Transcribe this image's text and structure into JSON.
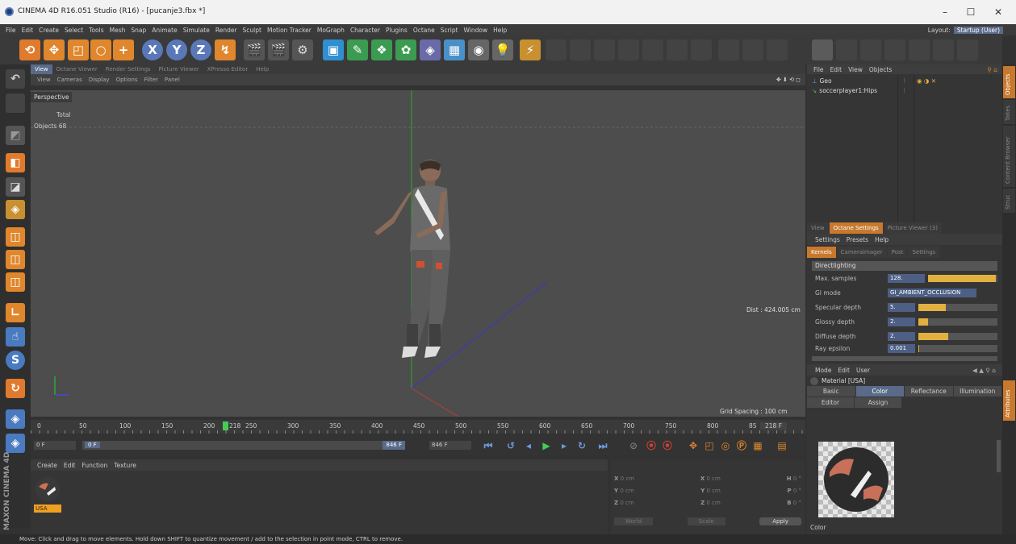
{
  "window": {
    "title": "CINEMA 4D R16.051 Studio (R16) - [pucanje3.fbx *]",
    "minimize": "–",
    "maximize": "☐",
    "close": "✕"
  },
  "menu": [
    "File",
    "Edit",
    "Create",
    "Select",
    "Tools",
    "Mesh",
    "Snap",
    "Animate",
    "Simulate",
    "Render",
    "Sculpt",
    "Motion Tracker",
    "MoGraph",
    "Character",
    "Plugins",
    "Octane",
    "Script",
    "Window",
    "Help"
  ],
  "layout": {
    "label": "Layout:",
    "value": "Startup (User)"
  },
  "toolbar": {
    "x_axis": "X",
    "y_axis": "Y",
    "z_axis": "Z"
  },
  "viewport_tabs": [
    "View",
    "Octane Viewer",
    "Render Settings",
    "Picture Viewer",
    "XPresso Editor",
    "Help"
  ],
  "viewport_menu": [
    "View",
    "Cameras",
    "Display",
    "Options",
    "Filter",
    "Panel"
  ],
  "viewport": {
    "camera": "Perspective",
    "hud_total": "Total",
    "hud_objects_label": "Objects",
    "hud_objects_value": "68",
    "dist": "Dist : 424.005 cm",
    "grid_spacing": "Grid Spacing : 100 cm"
  },
  "timeline": {
    "ticks": [
      "0",
      "50",
      "100",
      "150",
      "200",
      "218",
      "250",
      "300",
      "350",
      "400",
      "450",
      "500",
      "550",
      "600",
      "650",
      "700",
      "750",
      "800",
      "85"
    ],
    "current_frame": "218 F"
  },
  "playback": {
    "start": "0 F",
    "min": "0 F",
    "max": "846 F",
    "end": "846 F"
  },
  "material_manager": {
    "menu": [
      "Create",
      "Edit",
      "Function",
      "Texture"
    ],
    "material_name": "USA"
  },
  "coords": {
    "x": "X",
    "y": "Y",
    "z": "Z",
    "h": "H",
    "p": "P",
    "b": "B",
    "cm": "0 cm",
    "deg": "0 °",
    "world": "World",
    "scale": "Scale",
    "apply": "Apply"
  },
  "status": "Move: Click and drag to move elements. Hold down SHIFT to quantize movement / add to the selection in point mode, CTRL to remove.",
  "maxon": "MAXON CINEMA 4D",
  "object_manager": {
    "menu": [
      "File",
      "Edit",
      "View",
      "Objects"
    ],
    "objects": [
      "Geo",
      "soccerplayer1:Hips"
    ]
  },
  "right_strip": [
    "Objects",
    "Takes",
    "Content Browser",
    "Struc"
  ],
  "octane": {
    "tabs": [
      "View",
      "Octane Settings",
      "Picture Viewer (3)"
    ],
    "menu": [
      "Settings",
      "Presets",
      "Help"
    ],
    "subtabs": [
      "Kernels",
      "Cameraimager",
      "Post",
      "Settings"
    ],
    "section": "Directlighting",
    "props": [
      {
        "label": "Max. samples",
        "value": "128.",
        "fill": 0.98
      },
      {
        "label": "GI mode",
        "value": "GI_AMBIENT_OCCLUSION"
      },
      {
        "label": "Specular depth",
        "value": "5.",
        "fill": 0.35
      },
      {
        "label": "Glossy depth",
        "value": "2.",
        "fill": 0.12
      },
      {
        "label": "Diffuse depth",
        "value": "2.",
        "fill": 0.38
      },
      {
        "label": "Ray epsilon",
        "value": "0.001",
        "fill": 0.01
      }
    ]
  },
  "attributes": {
    "menu": [
      "Mode",
      "Edit",
      "User"
    ],
    "name": "Material [USA]",
    "tabs": [
      "Basic",
      "Color",
      "Reflectance",
      "Illumination"
    ],
    "tabs2": [
      "Editor",
      "Assign"
    ],
    "section": "Color",
    "side": "Attributes"
  },
  "colors": {
    "accent_blue": "#5a6b8a",
    "accent_orange": "#c8792d",
    "bg": "#323232"
  }
}
